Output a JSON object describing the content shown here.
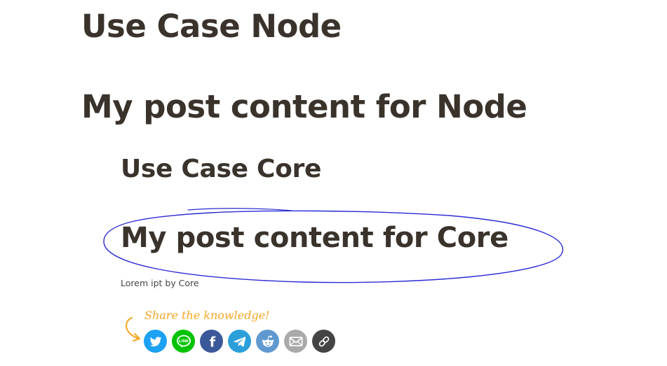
{
  "post": {
    "title": "Use Case Node",
    "subtitle": "My post content for Node",
    "embedded": {
      "title": "Use Case Core",
      "subtitle": "My post content for Core",
      "body": "Lorem ipt by Core"
    }
  },
  "share": {
    "label": "Share the knowledge!",
    "label_color": "#f5a623",
    "line_text": "LINE",
    "facebook_text": "f",
    "buttons": [
      {
        "name": "twitter",
        "icon": "twitter-bird-icon",
        "color": "#1da1f2"
      },
      {
        "name": "line",
        "icon": "line-icon",
        "color": "#00c300"
      },
      {
        "name": "facebook",
        "icon": "facebook-icon",
        "color": "#3b5998"
      },
      {
        "name": "telegram",
        "icon": "telegram-plane-icon",
        "color": "#2c9fdb"
      },
      {
        "name": "reddit",
        "icon": "reddit-alien-icon",
        "color": "#5f99cf"
      },
      {
        "name": "email",
        "icon": "envelope-icon",
        "color": "#a9a9a9"
      },
      {
        "name": "copy-link",
        "icon": "chain-link-icon",
        "color": "#444444"
      }
    ]
  },
  "annotation": {
    "stroke_color": "#2a2ad6"
  },
  "colors": {
    "text": "#3a332b",
    "background": "#ffffff"
  }
}
